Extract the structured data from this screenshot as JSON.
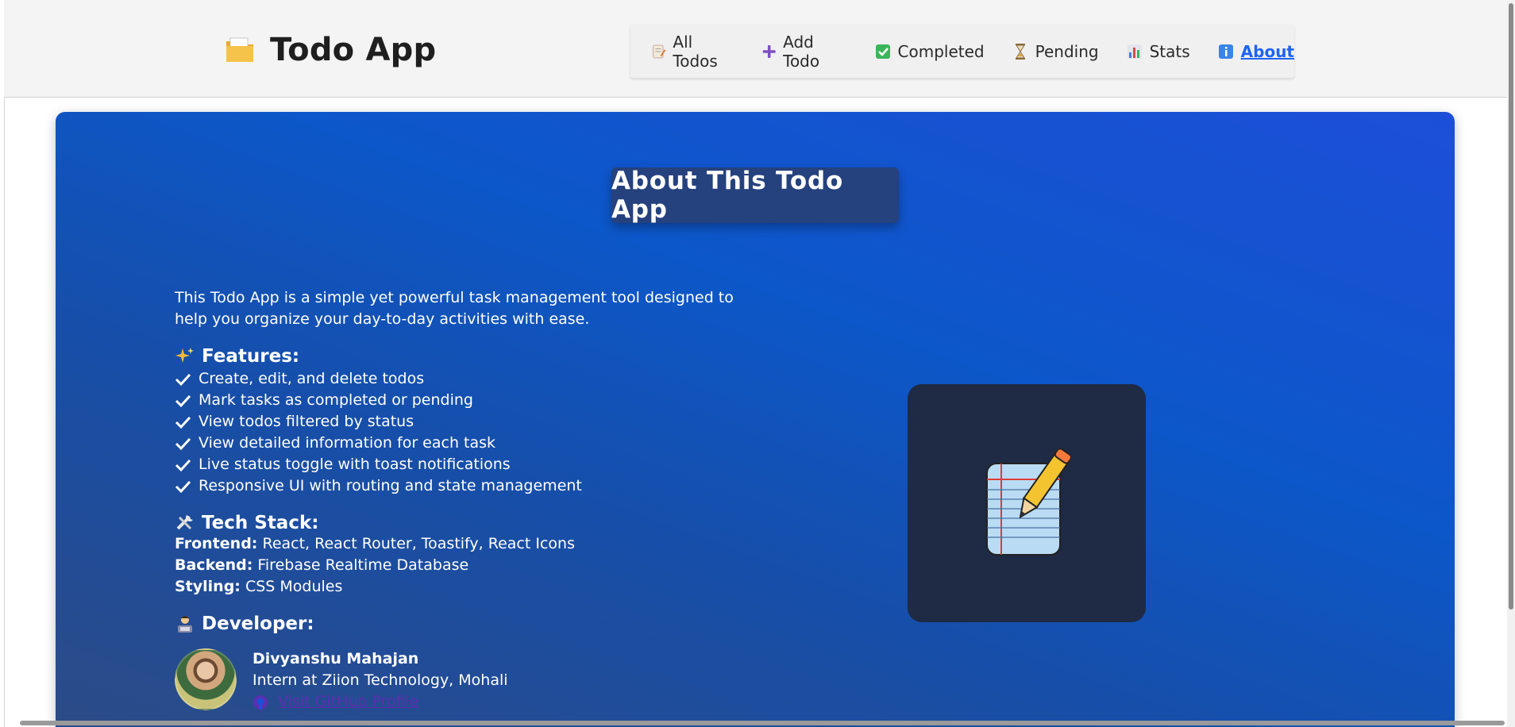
{
  "header": {
    "app_title": "Todo App",
    "brand_icon": "folder-icon",
    "nav": [
      {
        "label": "All Todos",
        "icon": "memo-icon",
        "active": false
      },
      {
        "label": "Add Todo",
        "icon": "plus-icon",
        "active": false
      },
      {
        "label": "Completed",
        "icon": "check-box-icon",
        "active": false
      },
      {
        "label": "Pending",
        "icon": "hourglass-icon",
        "active": false
      },
      {
        "label": "Stats",
        "icon": "bar-chart-icon",
        "active": false
      },
      {
        "label": "About",
        "icon": "info-icon",
        "active": true
      }
    ]
  },
  "about": {
    "title": "About This Todo App",
    "intro": "This Todo App is a simple yet powerful task management tool designed to help you organize your day-to-day activities with ease.",
    "features_title": "Features:",
    "features": [
      "Create, edit, and delete todos",
      "Mark tasks as completed or pending",
      "View todos filtered by status",
      "View detailed information for each task",
      "Live status toggle with toast notifications",
      "Responsive UI with routing and state management"
    ],
    "tech_title": "Tech Stack:",
    "tech": [
      {
        "label": "Frontend:",
        "value": "React, React Router, Toastify, React Icons"
      },
      {
        "label": "Backend:",
        "value": "Firebase Realtime Database"
      },
      {
        "label": "Styling:",
        "value": "CSS Modules"
      }
    ],
    "developer_title": "Developer:",
    "developer": {
      "name": "Divyanshu Mahajan",
      "role": "Intern at Ziion Technology, Mohali",
      "link_text": "Visit GitHub Profile"
    }
  },
  "colors": {
    "accent": "#1e64f0",
    "card_top": "#1d4fd8",
    "card_bottom": "#2c4b86",
    "title_box": "#25417e",
    "illustration_bg": "#1f2a44",
    "link": "#5b2fb0"
  }
}
